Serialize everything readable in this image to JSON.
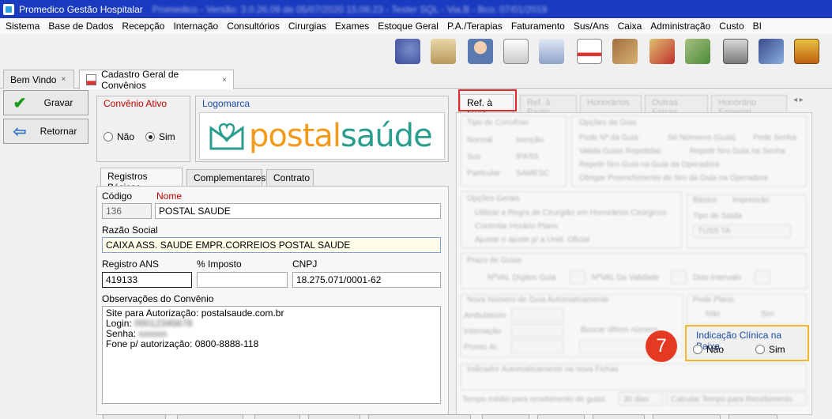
{
  "window": {
    "title": "Promedico Gestão Hospitalar",
    "title_extra": "Promedico - Versão: 3.0.26.09 de 05/07/2020 15:06:23 - Tester SQL - Via.B - Bco: 07/01/2019"
  },
  "menu": [
    "Sistema",
    "Base de Dados",
    "Recepção",
    "Internação",
    "Consultórios",
    "Cirurgias",
    "Exames",
    "Estoque Geral",
    "P.A./Terapias",
    "Faturamento",
    "Sus/Ans",
    "Caixa",
    "Administração",
    "Custo",
    "BI"
  ],
  "toolbar_icons": [
    "users-refresh-icon",
    "people-photo-icon",
    "doctor-icon",
    "clipboard-icon",
    "bed-icon",
    "ambulance-icon",
    "box-tools-icon",
    "money-up-icon",
    "money-down-icon",
    "safe-icon",
    "cash-register-icon",
    "phone-book-icon"
  ],
  "doc_tabs": [
    {
      "label": "Bem Vindo",
      "close": "×"
    },
    {
      "label": "Cadastro Geral de Convênios",
      "close": "×"
    }
  ],
  "side_buttons": {
    "save": "Gravar",
    "back": "Retornar"
  },
  "convenio_ativo": {
    "title": "Convênio Ativo",
    "options": [
      "Não",
      "Sim"
    ],
    "selected": "Sim"
  },
  "logomarca": {
    "title": "Logomarca",
    "logo_text_a": "postal",
    "logo_text_b": "saúde"
  },
  "form_tabs": [
    "Registros Básicos",
    "Complementares",
    "Contrato"
  ],
  "form": {
    "codigo_label": "Código",
    "codigo": "136",
    "nome_label": "Nome",
    "nome": "POSTAL SAUDE",
    "razao_label": "Razão Social",
    "razao": "CAIXA ASS. SAUDE EMPR.CORREIOS POSTAL SAUDE",
    "ans_label": "Registro ANS",
    "ans": "419133",
    "imposto_label": "% Imposto",
    "imposto": "",
    "cnpj_label": "CNPJ",
    "cnpj": "18.275.071/0001-62",
    "obs_label": "Observações do Convênio",
    "obs_lines": [
      {
        "text": "Site para Autorização: postalsaude.com.br",
        "hidden": ""
      },
      {
        "text": "Login: ",
        "hidden": "00012345678"
      },
      {
        "text": "Senha: ",
        "hidden": "xxxxxx"
      },
      {
        "text": "Fone p/ autorização: 0800-8888-118",
        "hidden": ""
      }
    ]
  },
  "right_tabs": [
    "Ref. à Guia",
    "Ref. à Pagto",
    "Honorários",
    "Outras Faixas",
    "Honorário Especial"
  ],
  "right_faded": {
    "tipo_convenio": "Tipo de Convênio",
    "tipo_opts": [
      "Normal",
      "Isenção",
      "Sus",
      "IPASS",
      "Particular",
      "SAMESC"
    ],
    "opcoes_guia": "Opções da Guia",
    "guia_opts": [
      "Pede Nº da Guia",
      "Só Números (Guia)",
      "Pede Senha",
      "Valida Guias Repetidas",
      "Repetir Nro Guia na Senha",
      "Repetir Nro Guia na Guia da Operadora",
      "Obrigar Preenchimento de Nro da Guia na Operadora"
    ],
    "opcoes_gerais": "Opções Gerais",
    "gerais_opts": [
      "Utilizar a Regra de Cirurgião em Honorários Cirúrgicos",
      "Controlar Horário Plano",
      "Ajustar o ajuste p/ a Unid. Oficial"
    ],
    "sub_tabs": [
      "Básico",
      "Impressão"
    ],
    "tipo_saida": "Tipo de Saída",
    "tipo_saida_val": "TUSS TA",
    "prazo_guia": "Prazo de Guias",
    "prazo_opts": [
      "NºVAL Dígitos Guia",
      "NºVAL Da Validade"
    ],
    "dias_interval": "Dias Intervalo",
    "nro_guia": "Nova Número de Guia Automaticamente",
    "ambulatorio": "Ambulatório",
    "internacao": "Internação",
    "pronto_at": "Pronto At.",
    "buscar": "Buscar último número",
    "pede_plano": "Pede Plano",
    "pede_opts": [
      "Não",
      "Sim"
    ],
    "indicador": "Indicador Automaticamente na nova Fichas",
    "tempo": "Tempo médio para recebimento de guias",
    "dias": "30 dias",
    "calcular": "Calcular Tempo para Recebimento"
  },
  "indicacao": {
    "title": "Indicação Clínica na Baixa",
    "options": [
      "Não",
      "Sim"
    ],
    "selected": ""
  },
  "callout": "7",
  "colors": {
    "titlebar": "#1a3bbf",
    "highlight_red": "#e02b2b",
    "highlight_yellow": "#f0b82a",
    "badge": "#e43a22"
  }
}
